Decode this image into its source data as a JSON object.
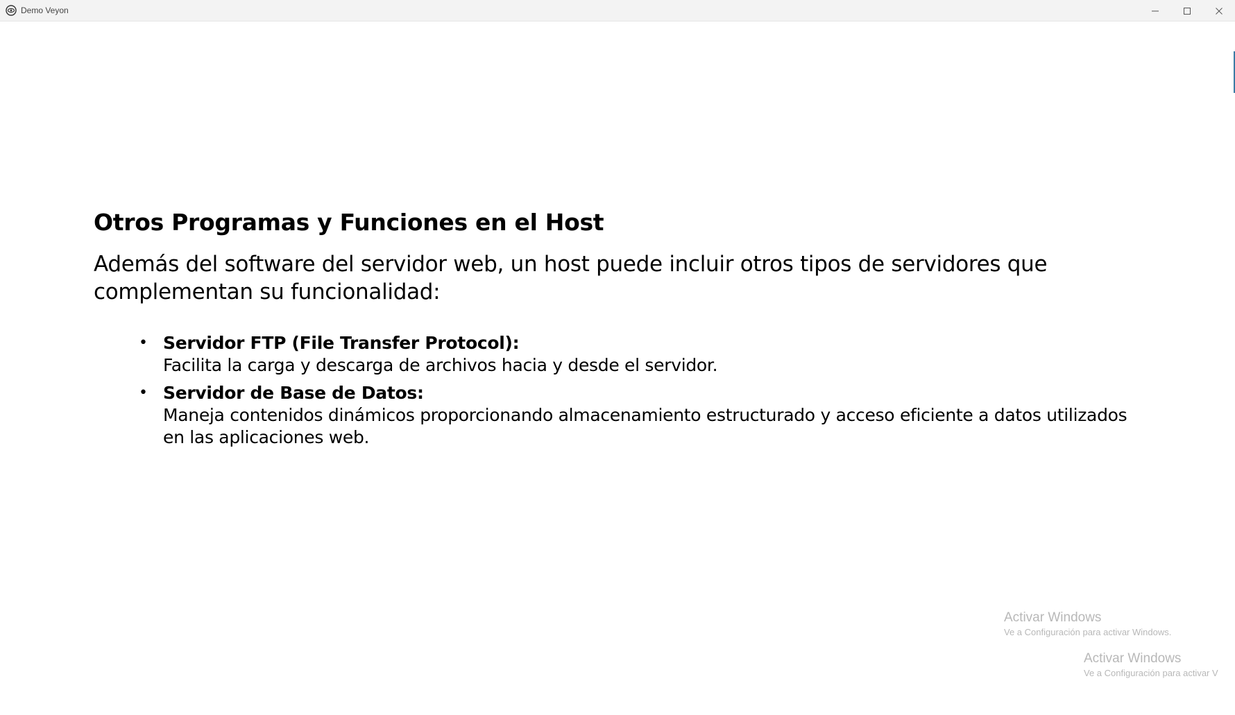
{
  "window": {
    "title": "Demo Veyon",
    "app_icon": "veyon-eye-icon",
    "controls": [
      "minimize-icon",
      "maximize-icon",
      "close-icon"
    ]
  },
  "slide": {
    "title": "Otros Programas y Funciones en el Host",
    "intro": "Además del software del servidor web, un host puede incluir otros tipos de servidores que complementan su funcionalidad:",
    "bullets": [
      {
        "heading": "Servidor FTP (File Transfer Protocol):",
        "text": "Facilita la carga y descarga de archivos hacia y desde el servidor."
      },
      {
        "heading": "Servidor de Base de Datos:",
        "text": "Maneja contenidos dinámicos proporcionando almacenamiento estructurado y acceso eficiente a datos utilizados en las aplicaciones web."
      }
    ]
  },
  "watermarks": [
    {
      "title": "Activar Windows",
      "subtitle": "Ve a Configuración para activar Windows."
    },
    {
      "title": "Activar Windows",
      "subtitle": "Ve a Configuración para activar V"
    }
  ]
}
